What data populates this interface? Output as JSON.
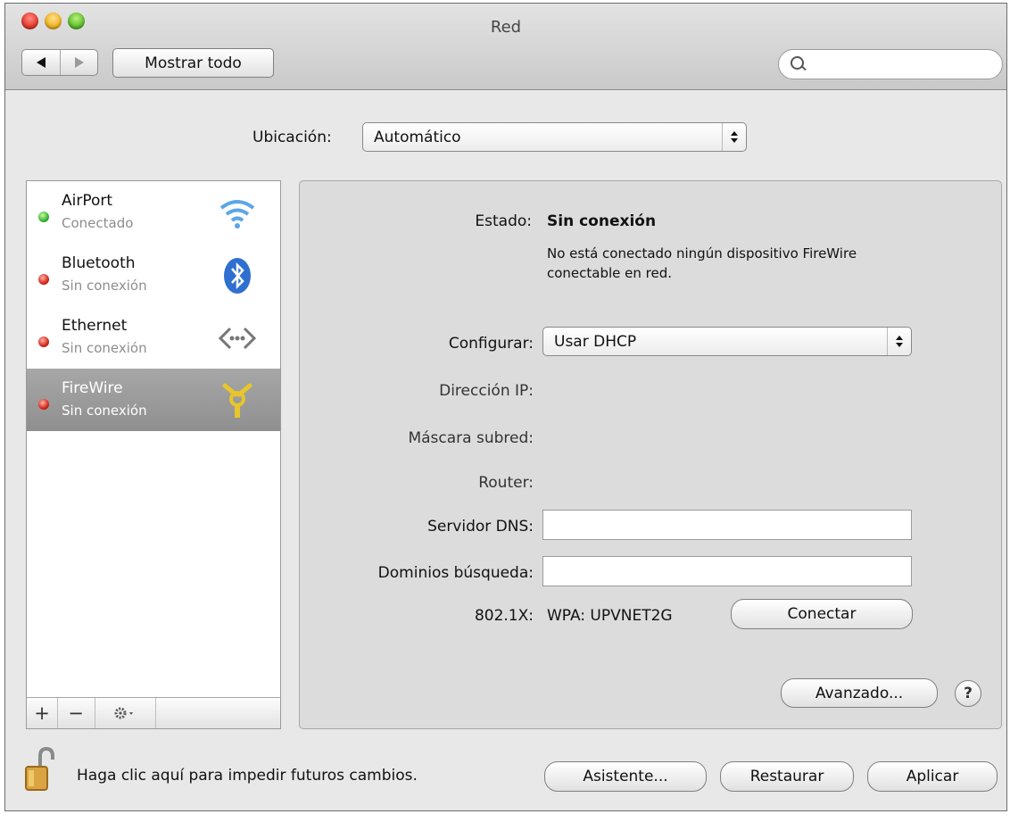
{
  "window": {
    "title": "Red"
  },
  "toolbar": {
    "show_all": "Mostrar todo"
  },
  "location": {
    "label": "Ubicación:",
    "value": "Automático"
  },
  "services": [
    {
      "name": "AirPort",
      "status": "Conectado",
      "status_color": "#39b034",
      "icon": "wifi-icon"
    },
    {
      "name": "Bluetooth",
      "status": "Sin conexión",
      "status_color": "#d52618",
      "icon": "bluetooth-icon"
    },
    {
      "name": "Ethernet",
      "status": "Sin conexión",
      "status_color": "#d52618",
      "icon": "ethernet-icon"
    },
    {
      "name": "FireWire",
      "status": "Sin conexión",
      "status_color": "#d52618",
      "icon": "firewire-icon",
      "selected": true
    }
  ],
  "sidebar_controls": {
    "add": "+",
    "remove": "−"
  },
  "panel": {
    "status_label": "Estado:",
    "status_value": "Sin conexión",
    "status_desc_line1": "No está conectado ningún dispositivo FireWire",
    "status_desc_line2": "conectable en red.",
    "configure_label": "Configurar:",
    "configure_value": "Usar DHCP",
    "ip_label": "Dirección IP:",
    "mask_label": "Máscara subred:",
    "router_label": "Router:",
    "dns_label": "Servidor DNS:",
    "dns_value": "",
    "domains_label": "Dominios búsqueda:",
    "domains_value": "",
    "dot1x_label": "802.1X:",
    "dot1x_value": "WPA: UPVNET2G",
    "connect_button": "Conectar",
    "advanced_button": "Avanzado...",
    "help_button": "?"
  },
  "footer": {
    "lock_text": "Haga clic aquí para impedir futuros cambios.",
    "assistant_button": "Asistente...",
    "revert_button": "Restaurar",
    "apply_button": "Aplicar"
  }
}
